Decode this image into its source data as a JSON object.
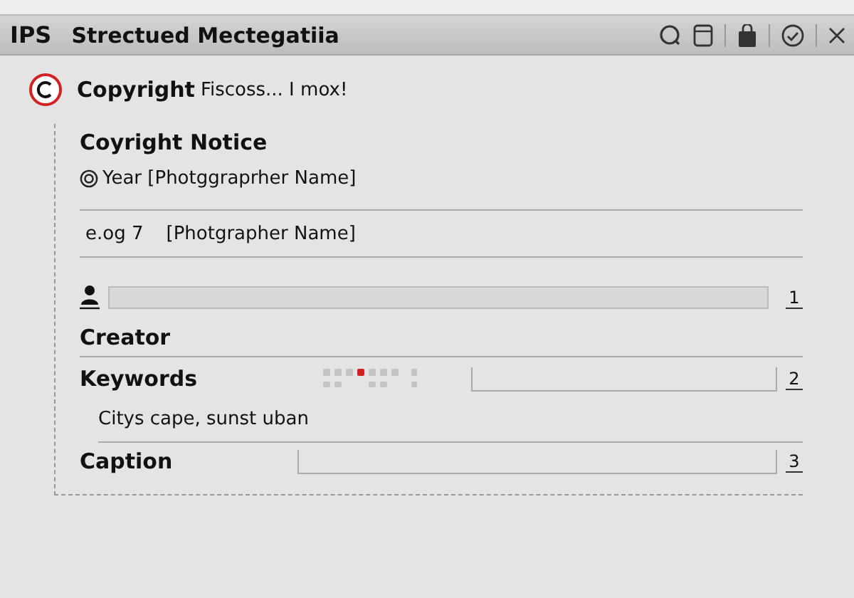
{
  "window": {
    "app": "IPS",
    "title": "Strectued Mectegatiia"
  },
  "header": {
    "label": "Copyright",
    "value": "Fiscoss... I mox!"
  },
  "notice": {
    "label": "Coyright Notice",
    "value": "Year [Photggraprher  Name]"
  },
  "example": {
    "prefix": "e.og 7",
    "value": "[Photgrapher Name]"
  },
  "fields": [
    {
      "kind": "person",
      "label": "Creator",
      "number": "1"
    },
    {
      "kind": "keywords",
      "label": "Keywords",
      "number": "2",
      "value": "Citys cape, sunst uban"
    },
    {
      "kind": "caption",
      "label": "Caption",
      "number": "3"
    }
  ]
}
